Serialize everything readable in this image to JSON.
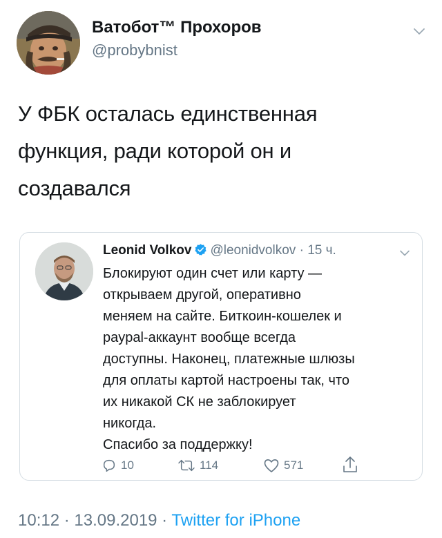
{
  "author": {
    "display_name": "Ватобот™ Прохоров",
    "handle": "@probybnist"
  },
  "tweet": {
    "text": "У ФБК осталась единственная\nфункция, ради которой он и\nсоздавался"
  },
  "quoted": {
    "display_name": "Leonid Volkov",
    "handle": "@leonidvolkov",
    "separator": "·",
    "time": "15 ч.",
    "text": "Блокируют один счет или карту —\nоткрываем другой, оперативно\nменяем на сайте. Биткоин-кошелек и\npaypal-аккаунт вообще всегда\nдоступны. Наконец, платежные шлюзы\nдля оплаты картой настроены так, что\nих никакой СК не заблокирует\nникогда.\nСпасибо за поддержку!",
    "replies": "10",
    "retweets": "114",
    "likes": "571"
  },
  "footer": {
    "time": "10:12",
    "dot1": " · ",
    "date": "13.09.2019",
    "dot2": " · ",
    "source": "Twitter for iPhone"
  },
  "colors": {
    "link_blue": "#1da1f2",
    "secondary_gray": "#657786",
    "border": "#d5dde3"
  },
  "icons": {
    "verified": "verified-badge-icon",
    "reply": "reply-icon",
    "retweet": "retweet-icon",
    "like": "heart-icon",
    "share": "share-icon",
    "caret": "chevron-down-icon"
  }
}
